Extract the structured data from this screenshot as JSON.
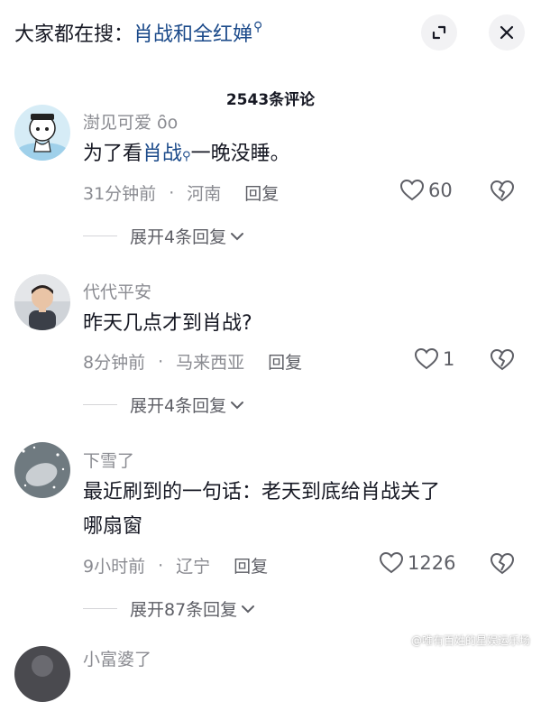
{
  "header": {
    "search_prefix": "大家都在搜：",
    "search_keyword": "肖战和全红婵",
    "expand_icon": "expand-icon",
    "close_icon": "close-icon"
  },
  "comment_count": "2543条评论",
  "comments": [
    {
      "username": "澍见可爱 ο̑̑ο",
      "content_before": "为了看",
      "content_link": "肖战",
      "content_after": "一晚没睡。",
      "time": "31分钟前",
      "location": "河南",
      "reply_label": "回复",
      "likes": "60",
      "expand_label": "展开4条回复"
    },
    {
      "username": "代代平安",
      "content": "昨天几点才到肖战?",
      "time": "8分钟前",
      "location": "马来西亚",
      "reply_label": "回复",
      "likes": "1",
      "expand_label": "展开4条回复"
    },
    {
      "username": "下雪了",
      "content_line1": "最近刷到的一句话：老天到底给肖战关了",
      "content_line2": "哪扇窗",
      "time": "9小时前",
      "location": "辽宁",
      "reply_label": "回复",
      "likes": "1226",
      "expand_label": "展开87条回复"
    }
  ],
  "next_comment": {
    "username": "小富婆了"
  },
  "watermark": "@唯有百姓的星娱运乐场",
  "colors": {
    "keyword": "#1b4a8a",
    "text": "#161823",
    "muted": "#8a8b91",
    "button_bg": "#f2f2f4"
  }
}
